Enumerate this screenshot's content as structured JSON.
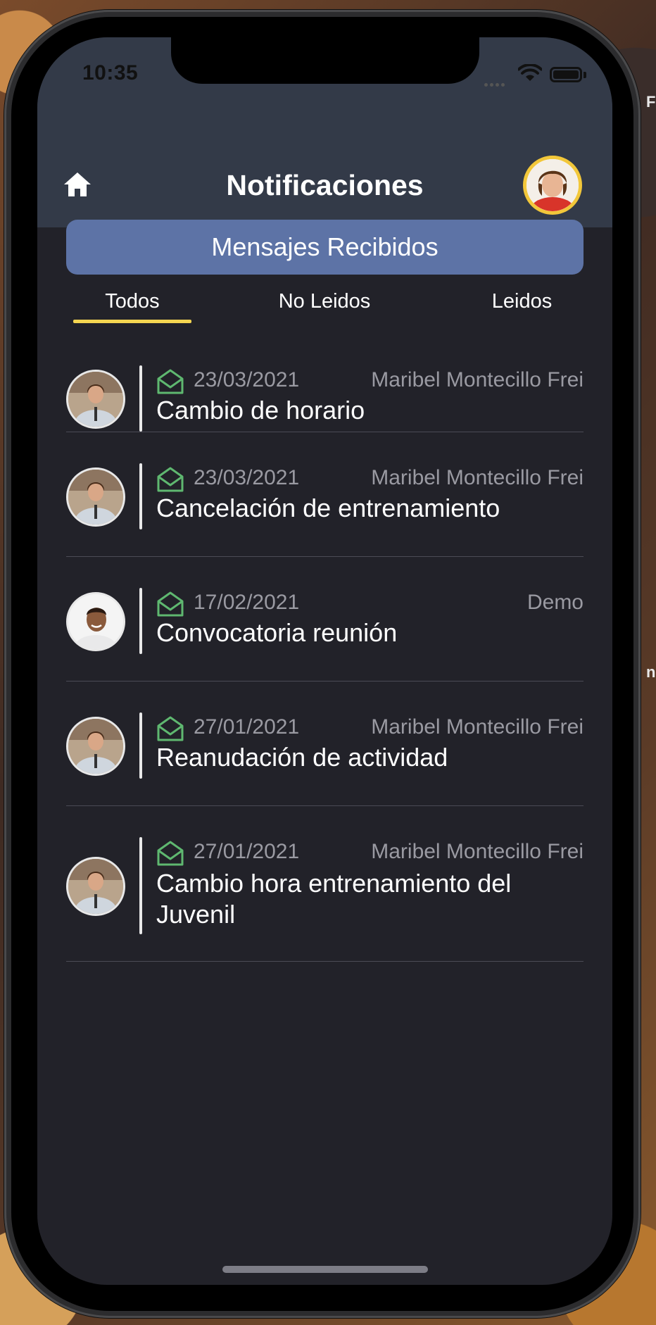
{
  "status_bar": {
    "time": "10:35"
  },
  "header": {
    "title": "Notificaciones"
  },
  "section_button": {
    "label": "Mensajes Recibidos"
  },
  "tabs": [
    {
      "label": "Todos",
      "active": true
    },
    {
      "label": "No Leidos",
      "active": false
    },
    {
      "label": "Leidos",
      "active": false
    }
  ],
  "messages": [
    {
      "date": "23/03/2021",
      "sender": "Maribel Montecillo Frei",
      "subject": "Cambio de horario",
      "avatar": "woman-avatar",
      "status_icon": "envelope-open-icon"
    },
    {
      "date": "23/03/2021",
      "sender": "Maribel Montecillo Frei",
      "subject": "Cancelación de entrenamiento",
      "avatar": "woman-avatar",
      "status_icon": "envelope-open-icon"
    },
    {
      "date": "17/02/2021",
      "sender": "Demo",
      "subject": "Convocatoria reunión",
      "avatar": "man-avatar",
      "status_icon": "envelope-open-icon"
    },
    {
      "date": "27/01/2021",
      "sender": "Maribel Montecillo Frei",
      "subject": "Reanudación de actividad",
      "avatar": "woman-avatar",
      "status_icon": "envelope-open-icon"
    },
    {
      "date": "27/01/2021",
      "sender": "Maribel Montecillo Frei",
      "subject": "Cambio hora  entrenamiento del Juvenil",
      "avatar": "woman-avatar",
      "status_icon": "envelope-open-icon"
    }
  ],
  "colors": {
    "app_bar": "#333a48",
    "background": "#222229",
    "section_button": "#5d73a6",
    "tab_underline": "#f5d651",
    "read_icon": "#5fb870",
    "muted_text": "#9a9aa2"
  },
  "backdrop": {
    "edge_text_top": "F",
    "edge_text_mid": "n"
  }
}
